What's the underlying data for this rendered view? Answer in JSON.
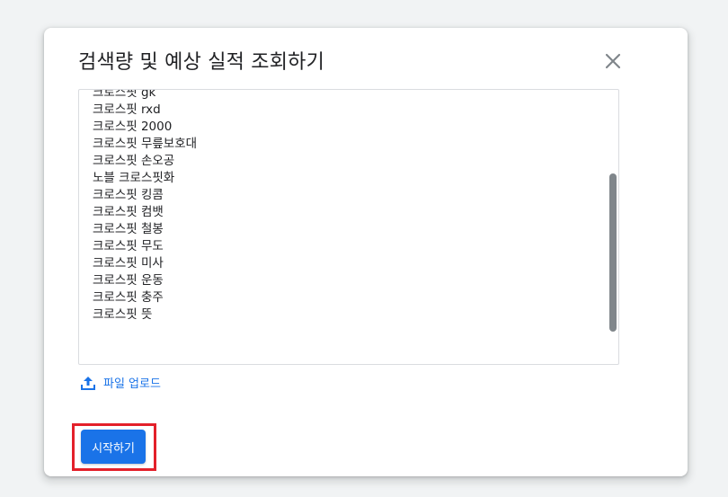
{
  "dialog": {
    "title": "검색량 및 예상 실적 조회하기",
    "keywords": [
      "크로스핏 gk",
      "크로스핏 rxd",
      "크로스핏 2000",
      "크로스핏 무릎보호대",
      "크로스핏 손오공",
      "노블 크로스핏화",
      "크로스핏 킹콤",
      "크로스핏 컴뱃",
      "크로스핏 철봉",
      "크로스핏 무도",
      "크로스핏 미사",
      "크로스핏 운동",
      "크로스핏 충주",
      "크로스핏 뜻"
    ],
    "upload_label": "파일 업로드",
    "start_label": "시작하기"
  },
  "icons": {
    "close": "close-icon",
    "upload": "upload-icon"
  },
  "colors": {
    "accent": "#1a73e8",
    "highlight": "#e3202a"
  }
}
